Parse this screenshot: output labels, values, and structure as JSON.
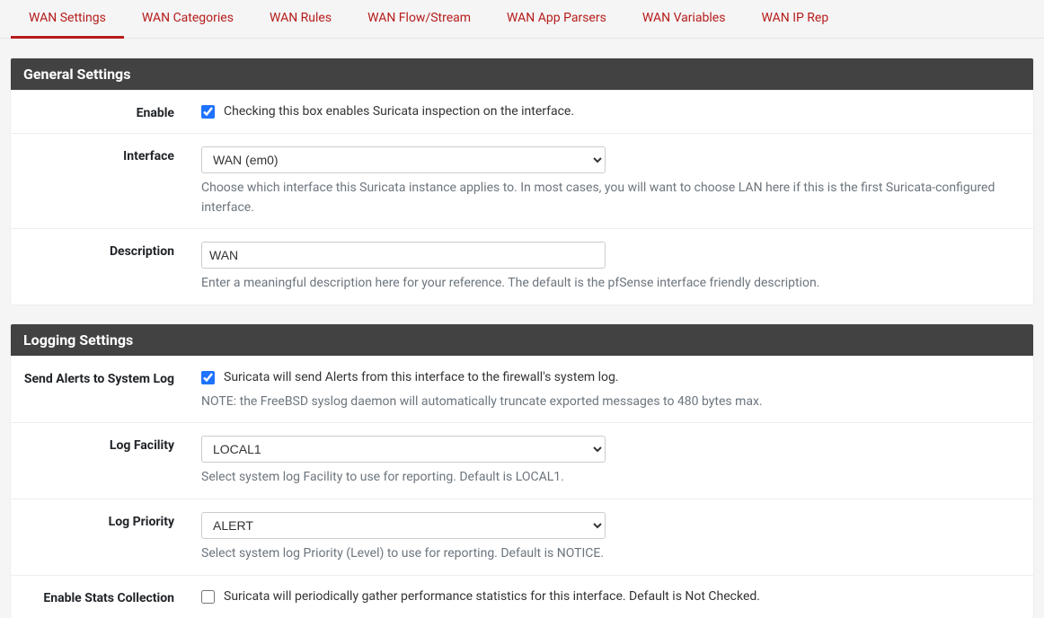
{
  "tabs": [
    {
      "label": "WAN Settings"
    },
    {
      "label": "WAN Categories"
    },
    {
      "label": "WAN Rules"
    },
    {
      "label": "WAN Flow/Stream"
    },
    {
      "label": "WAN App Parsers"
    },
    {
      "label": "WAN Variables"
    },
    {
      "label": "WAN IP Rep"
    }
  ],
  "general": {
    "title": "General Settings",
    "enable": {
      "label": "Enable",
      "checked": true,
      "text": "Checking this box enables Suricata inspection on the interface."
    },
    "interface": {
      "label": "Interface",
      "value": "WAN (em0)",
      "help": "Choose which interface this Suricata instance applies to. In most cases, you will want to choose LAN here if this is the first Suricata-configured interface."
    },
    "description": {
      "label": "Description",
      "value": "WAN",
      "help": "Enter a meaningful description here for your reference. The default is the pfSense interface friendly description."
    }
  },
  "logging": {
    "title": "Logging Settings",
    "send_alerts": {
      "label": "Send Alerts to System Log",
      "checked": true,
      "text": "Suricata will send Alerts from this interface to the firewall's system log.",
      "note": "NOTE: the FreeBSD syslog daemon will automatically truncate exported messages to 480 bytes max."
    },
    "log_facility": {
      "label": "Log Facility",
      "value": "LOCAL1",
      "help": "Select system log Facility to use for reporting. Default is LOCAL1."
    },
    "log_priority": {
      "label": "Log Priority",
      "value": "ALERT",
      "help": "Select system log Priority (Level) to use for reporting. Default is NOTICE."
    },
    "enable_stats": {
      "label": "Enable Stats Collection",
      "checked": false,
      "text": "Suricata will periodically gather performance statistics for this interface. Default is Not Checked."
    }
  }
}
